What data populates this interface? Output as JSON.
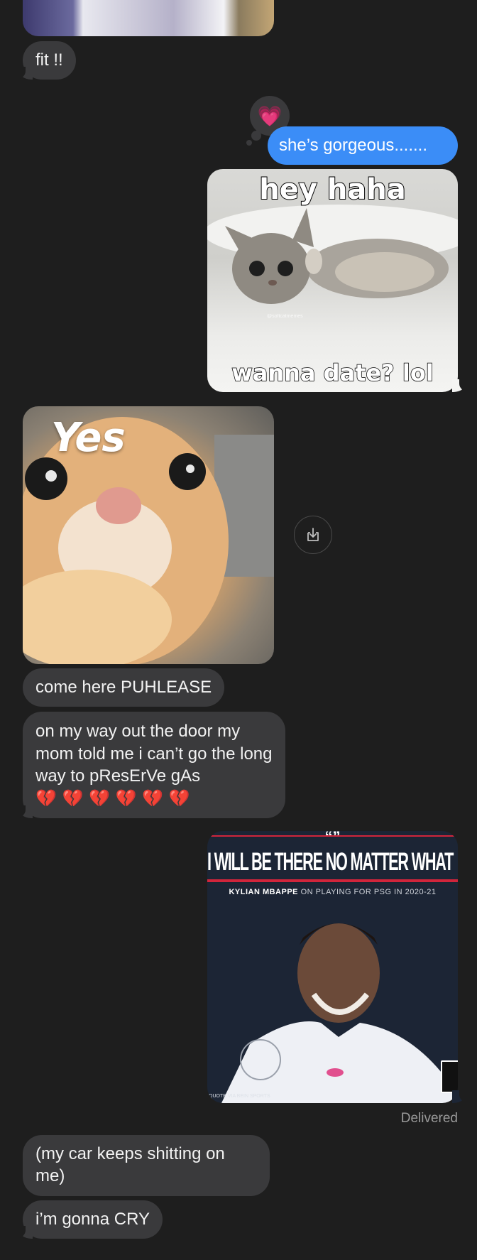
{
  "messages": {
    "fit": "fit !!",
    "gorgeous": "she’s gorgeous.......",
    "come_here": "come here PUHLEASE",
    "on_my_way": "on my way out the door my mom told me i can’t go the long way to pResErVe gAs",
    "broken_hearts": "💔 💔 💔 💔 💔 💔",
    "car": "(my car keeps shitting on me)",
    "cry": "i’m gonna CRY"
  },
  "tapback": {
    "emoji": "💗"
  },
  "meme_kitten": {
    "top": "hey haha",
    "bottom": "wanna date? lol",
    "watermark": "@softcatmemes"
  },
  "meme_yes": {
    "text": "Yes"
  },
  "meme_mbappe": {
    "quote_mark": "“”",
    "headline": "I WILL BE THERE NO MATTER WHAT",
    "sub_name": "KYLIAN MBAPPE",
    "sub_rest": " ON PLAYING FOR PSG IN 2020-21",
    "credit": "QUOTE VIA BEIN SPORTS"
  },
  "status": {
    "delivered": "Delivered"
  },
  "icons": {
    "save": "save-to-photos-icon",
    "tapback": "pink-heart-icon"
  },
  "colors": {
    "background": "#1e1e1e",
    "incoming_bubble": "#3a3a3c",
    "outgoing_bubble": "#3b8df7"
  }
}
